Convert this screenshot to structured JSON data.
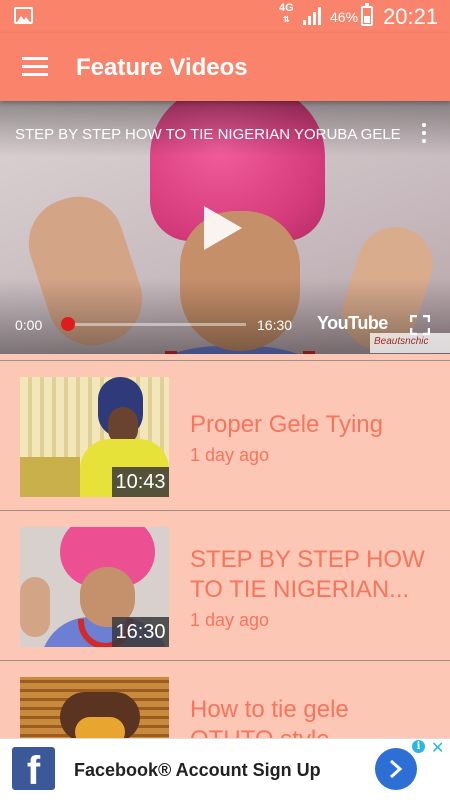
{
  "status_bar": {
    "network": "4G",
    "network_arrows": "⇅",
    "battery_percent": "46%",
    "battery_level": 0.46,
    "time": "20:21"
  },
  "app_bar": {
    "title": "Feature Videos",
    "menu_icon": "hamburger-menu-icon"
  },
  "player": {
    "title": "STEP BY STEP HOW TO TIE NIGERIAN YORUBA GELE",
    "elapsed": "0:00",
    "duration": "16:30",
    "progress": 0.0,
    "brand": "YouTube",
    "watermark": "Beautsnchic"
  },
  "videos": [
    {
      "title": "Proper Gele Tying",
      "age": "1 day ago",
      "duration": "10:43"
    },
    {
      "title_line1": "STEP BY STEP HOW",
      "title_line2": "TO TIE NIGERIAN...",
      "age": "1 day ago",
      "duration": "16:30"
    },
    {
      "title_line1": "How to tie gele",
      "title_line2": "OTUTO style",
      "age": ""
    }
  ],
  "ad": {
    "text": "Facebook® Account Sign Up",
    "logo_letter": "f",
    "info": "i",
    "close": "✕"
  },
  "colors": {
    "accent": "#f9846b",
    "background": "#fdc7b6",
    "item_text": "#f6755c"
  }
}
